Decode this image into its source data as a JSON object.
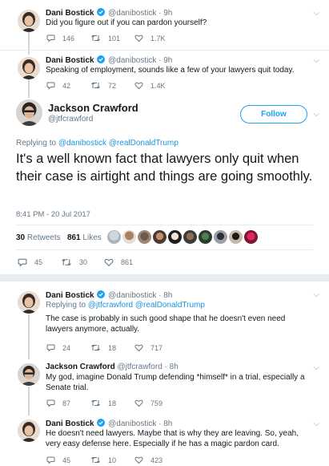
{
  "colors": {
    "link": "#1b95e0",
    "verified": "#1da1f2",
    "meta": "#657786",
    "separator": "#e6ecf0"
  },
  "tweets": [
    {
      "name": "Dani Bostick",
      "handle": "@danibostick",
      "time": "· 9h",
      "text": "Did you figure out if you can pardon yourself?",
      "replies": "146",
      "retweets": "101",
      "likes": "1.7K"
    },
    {
      "name": "Dani Bostick",
      "handle": "@danibostick",
      "time": "· 9h",
      "text": "Speaking of employment, sounds like a few of your lawyers quit today.",
      "replies": "42",
      "retweets": "72",
      "likes": "1.4K"
    }
  ],
  "main": {
    "name": "Jackson Crawford",
    "handle": "@jtfcrawford",
    "follow_label": "Follow",
    "replying_prefix": "Replying to",
    "reply_to_1": "@danibostick",
    "reply_to_2": "@realDonaldTrump",
    "text": "It's a well known fact that lawyers only quit when their case is airtight and things are going smoothly.",
    "timestamp": "8:41 PM - 20 Jul 2017",
    "retweets_count": "30",
    "retweets_label": "Retweets",
    "likes_count": "861",
    "likes_label": "Likes",
    "replies": "45",
    "retweets": "30",
    "likes": "861"
  },
  "replies": [
    {
      "name": "Dani Bostick",
      "handle": "@danibostick",
      "time": "· 8h",
      "replying_prefix": "Replying to",
      "reply_to_1": "@jtfcrawford",
      "reply_to_2": "@realDonaldTrump",
      "text": "The case is probably in such good shape that he doesn't even need lawyers anymore, actually.",
      "replies": "24",
      "retweets": "18",
      "likes": "717"
    },
    {
      "name": "Jackson Crawford",
      "handle": "@jtfcrawford",
      "time": "· 8h",
      "text": "My god, imagine Donald Trump defending *himself* in a trial, especially a Senate trial.",
      "replies": "87",
      "retweets": "18",
      "likes": "759"
    },
    {
      "name": "Dani Bostick",
      "handle": "@danibostick",
      "time": "· 8h",
      "text": "He doesn't need lawyers. Maybe that is why they are leaving. So, yeah, very easy defense here. Especially if he has a magic pardon card.",
      "replies": "45",
      "retweets": "10",
      "likes": "423"
    }
  ]
}
